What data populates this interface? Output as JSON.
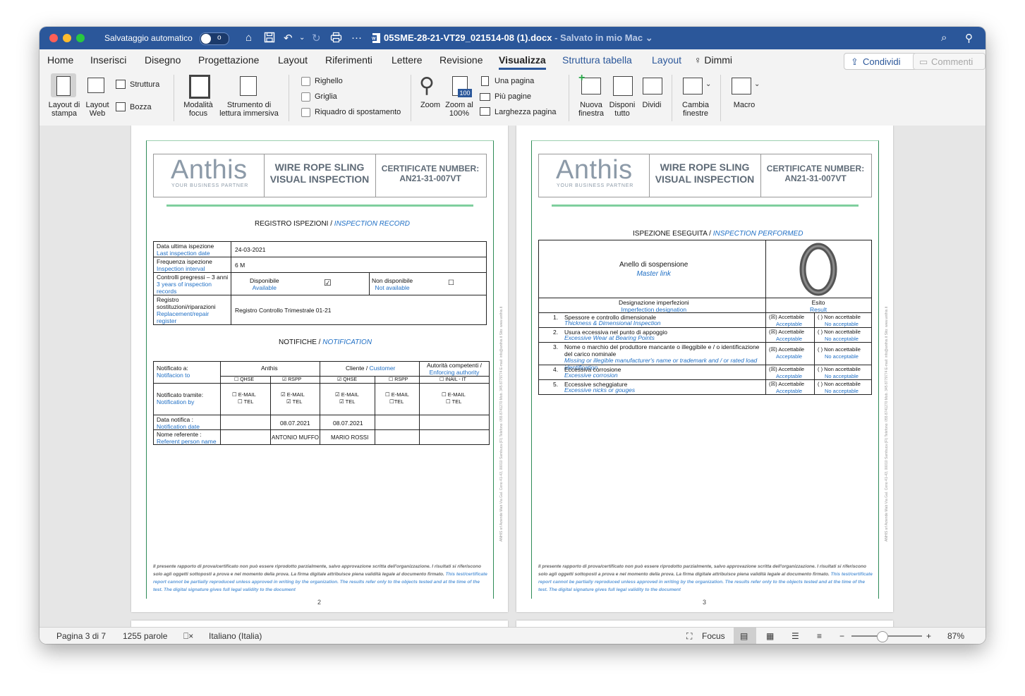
{
  "titlebar": {
    "autosave_label": "Salvataggio automatico",
    "autosave_state": "o",
    "doc_name": "05SME-28-21-VT29_021514-08 (1).docx",
    "doc_status": "- Salvato in mio Mac"
  },
  "tabs": [
    "Home",
    "Inserisci",
    "Disegno",
    "Progettazione",
    "Layout",
    "Riferimenti",
    "Lettere",
    "Revisione",
    "Visualizza",
    "Struttura tabella",
    "Layout",
    "Dimmi"
  ],
  "share_label": "Condividi",
  "comments_label": "Commenti",
  "ribbon": {
    "layout_stampa": "Layout di stampa",
    "layout_web": "Layout Web",
    "struttura": "Struttura",
    "bozza": "Bozza",
    "modalita_focus": "Modalità focus",
    "lettura_immersiva": "Strumento di lettura immersiva",
    "righello": "Righello",
    "griglia": "Griglia",
    "riquadro": "Riquadro di spostamento",
    "zoom": "Zoom",
    "zoom100": "Zoom al 100%",
    "zoom100_badge": "100",
    "una_pagina": "Una pagina",
    "piu_pagine": "Più pagine",
    "larghezza_pagina": "Larghezza pagina",
    "nuova_finestra": "Nuova finestra",
    "disponi_tutto": "Disponi tutto",
    "dividi": "Dividi",
    "cambia_finestre": "Cambia finestre",
    "macro": "Macro"
  },
  "header": {
    "logo": "Anthis",
    "tagline": "YOUR BUSINESS PARTNER",
    "title_line1": "WIRE ROPE SLING",
    "title_line2": "VISUAL INSPECTION",
    "cert_line1": "CERTIFICATE NUMBER:",
    "cert_line2": "AN21-31-007VT"
  },
  "page2": {
    "record_title": "REGISTRO ISPEZIONI / ",
    "record_title_en": "INSPECTION RECORD",
    "rows": {
      "last_it": "Data ultima ispezione",
      "last_en": "Last inspection date",
      "last_val": "24-03-2021",
      "freq_it": "Frequenza ispezione",
      "freq_en": "Inspection interval",
      "freq_val": "6 M",
      "prev_it": "Controlli pregressi – 3 anni",
      "prev_en": "3 years of inspection records",
      "disp_it": "Disponibile",
      "disp_en": "Available",
      "disp_mark": "☑",
      "nondisp_it": "Non disponibile",
      "nondisp_en": "Not available",
      "nondisp_mark": "☐",
      "repl_it": "Registro sostituzioni/riparazioni",
      "repl_en": "Replacement/repair register",
      "repl_val": "Registro Controllo Trimestrale 01-21"
    },
    "notif_title": "NOTIFICHE / ",
    "notif_title_en": "NOTIFICATION",
    "notif": {
      "to_it": "Notificato a:",
      "to_en": "Notifacion to",
      "anthis": "Anthis",
      "cliente": "Cliente / ",
      "customer": "Customer",
      "auth_it": "Autorità competenti /",
      "auth_en": "Enforcing authority",
      "col1": "☐ QHSE",
      "col2": "☑ RSPP",
      "col3": "☑ QHSE",
      "col4": "☐ RSPP",
      "col5": "☐ INAIL - IT",
      "by_it": "Notificato tramite:",
      "by_en": "Notification by",
      "m1a": "☐ E-MAIL",
      "m1b": "☐ TEL",
      "m2a": "☑ E-MAIL",
      "m2b": "☑ TEL",
      "m3a": "☑ E-MAIL",
      "m3b": "☑ TEL",
      "m4a": "☐ E-MAIL",
      "m4b": "☐TEL",
      "m5a": "☐ E-MAIL",
      "m5b": "☐ TEL",
      "date_it": "Data notifica :",
      "date_en": "Notification date",
      "date2": "08.07.2021",
      "date3": "08.07.2021",
      "ref_it": "Nome referente :",
      "ref_en": "Referent person name",
      "ref2": "ANTONIO MUFFO",
      "ref3": "MARIO ROSSI"
    },
    "page_number": "2"
  },
  "page3": {
    "perf_title": "ISPEZIONE ESEGUITA / ",
    "perf_title_en": "INSPECTION PERFORMED",
    "item_it": "Anello di sospensione",
    "item_en": "Master link",
    "designation_it": "Designazione imperfezioni",
    "designation_en": "Imperfection designation",
    "result_it": "Esito",
    "result_en": "Result",
    "rows": [
      {
        "n": "1.",
        "it": "Spessore e controllo dimensionale",
        "en": "Thickness & Dimensional Inspection"
      },
      {
        "n": "2.",
        "it": "Usura eccessiva nel punto di appoggio",
        "en": "Excessive Wear at Bearing Points"
      },
      {
        "n": "3.",
        "it": "Nome o marchio del produttore mancante o illeggibile e / o identificazione del carico nominale",
        "en": "Missing or illegible manufacturer's name or trademark and / or rated load identification"
      },
      {
        "n": "4.",
        "it": "Eccessiva corrosione",
        "en": "Excessive corrosion"
      },
      {
        "n": "5.",
        "it": "Eccessive scheggiature",
        "en": "Excessive nicks or gouges"
      }
    ],
    "acc_it": "(☒)  Accettabile",
    "acc_en": "Acceptable",
    "nacc_it": "(  )  Non accettabile",
    "nacc_en": "No acceptable",
    "page_number": "3"
  },
  "footer": {
    "it": "Il presente rapporto di prova/certificato non può essere riprodotto parzialmente, salvo approvazione scritta dell'organizzazione. I risultati si riferiscono solo agli oggetti sottoposti a prova e nel momento della prova. La firma digitale attribuisce piena validità legale al documento firmato.",
    "en": "This test/certificate report cannot be partially reproduced unless approved in writing by the organization. The results refer only to the objects tested and at the time of the test. The digital signature gives full legal validity to the document"
  },
  "sidetext": "ANHIS srl Aziende Mab Via Gal. Ceno 41-43, 00010 Sambuca (FI) Telefono: 055 8741270 Mob. 345 8779774 E-mail: info@anthis.it Sito: www.anthis.it",
  "status": {
    "page": "Pagina 3 di 7",
    "words": "1255 parole",
    "language": "Italiano (Italia)",
    "focus": "Focus",
    "zoom": "87%"
  }
}
